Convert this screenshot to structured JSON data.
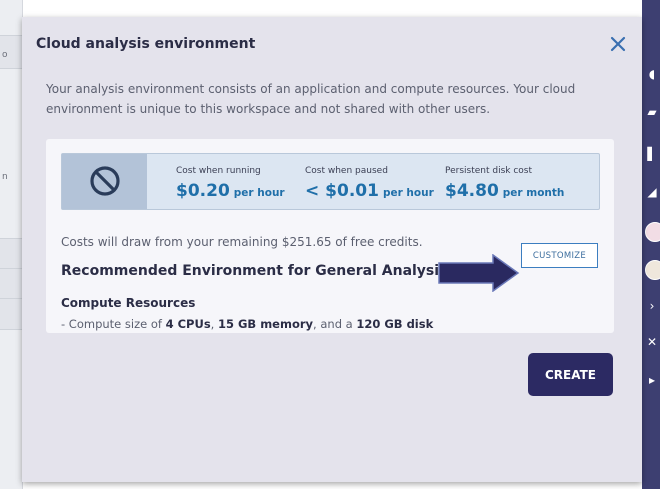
{
  "modal": {
    "title": "Cloud analysis environment",
    "description": "Your analysis environment consists of an application and compute resources. Your cloud environment is unique to this workspace and not shared with other users.",
    "close_icon": "close-icon"
  },
  "costs": {
    "icon": "no-symbol-icon",
    "running": {
      "label": "Cost when running",
      "amount": "$0.20",
      "unit": "per hour"
    },
    "paused": {
      "label": "Cost when paused",
      "amount": "< $0.01",
      "unit": "per hour"
    },
    "disk": {
      "label": "Persistent disk cost",
      "amount": "$4.80",
      "unit": "per month"
    }
  },
  "credits_text": "Costs will draw from your remaining $251.65 of free credits.",
  "environment": {
    "title": "Recommended Environment for General Analysis",
    "customize_label": "CUSTOMIZE",
    "annotation_icon": "arrow-right-icon"
  },
  "compute": {
    "title": "Compute Resources",
    "prefix": "- Compute size of ",
    "cpus": "4 CPUs",
    "sep1": ", ",
    "memory": "15 GB memory",
    "sep2": ", and a ",
    "disk": "120 GB disk"
  },
  "create_label": "CREATE",
  "background": {
    "left_snippets": [
      "o",
      "n"
    ]
  },
  "colors": {
    "modal_bg": "#e4e3ec",
    "cost_banner_bg": "#dce6f2",
    "accent_blue": "#1f6fa9",
    "primary_button": "#2c2a63",
    "sidebar": "#3d3f71",
    "annotation_arrow": "#2a2960"
  }
}
